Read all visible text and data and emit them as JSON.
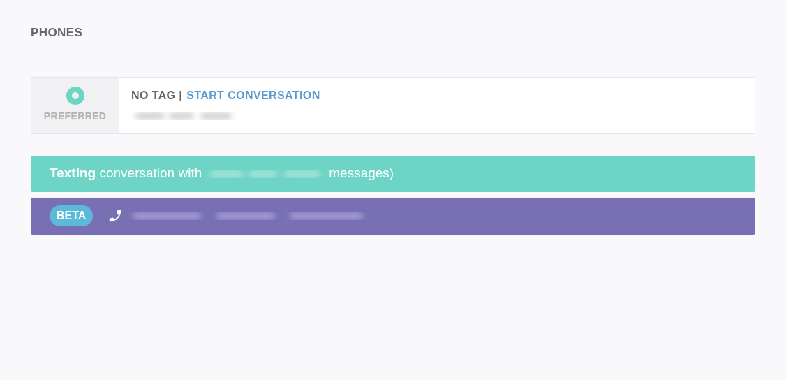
{
  "section_title": "PHONES",
  "phone": {
    "preferred": true,
    "preferred_label": "PREFERRED",
    "tag": "NO TAG |",
    "action": "START CONVERSATION"
  },
  "texting_bar": {
    "text": "**Texting** conversation with",
    "suffix": "messages)"
  },
  "call_bar": {
    "badge": "BETA"
  }
}
